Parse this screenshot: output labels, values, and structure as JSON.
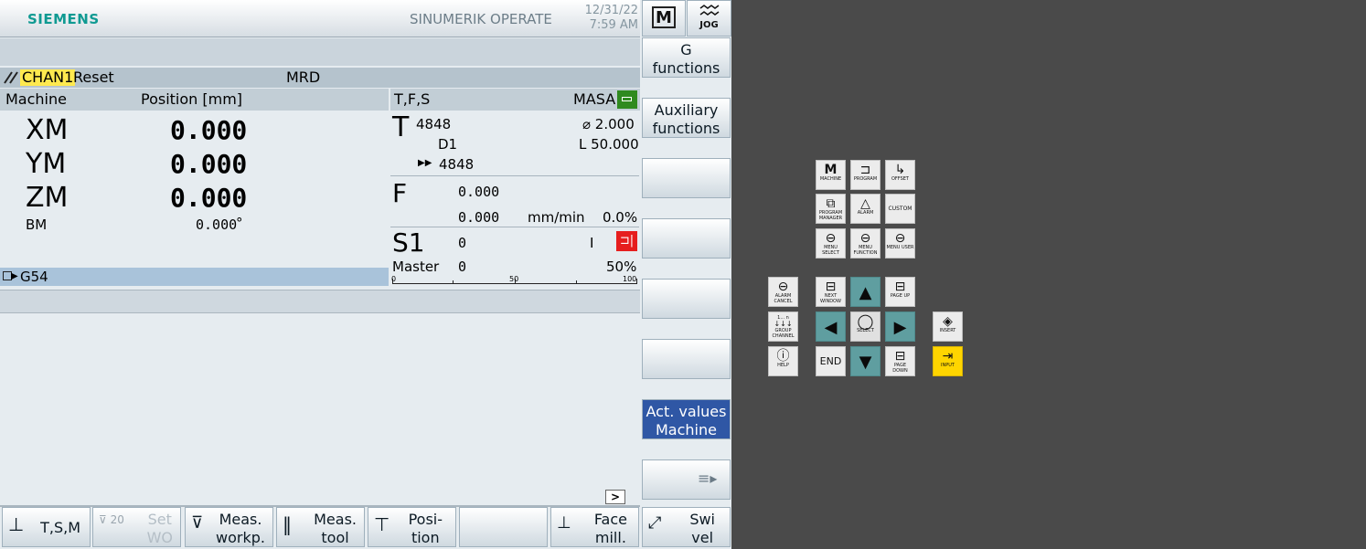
{
  "header": {
    "brand": "SIEMENS",
    "title": "SINUMERIK OPERATE",
    "date": "12/31/22",
    "time": "7:59 AM",
    "mode_m_label": "M",
    "mode_jog_label": "JOG"
  },
  "channel": {
    "name": "CHAN1",
    "state": "Reset",
    "program": "MRD"
  },
  "position": {
    "col_machine": "Machine",
    "col_position": "Position [mm]",
    "axes": [
      {
        "name": "XM",
        "value": "0.000"
      },
      {
        "name": "YM",
        "value": "0.000"
      },
      {
        "name": "ZM",
        "value": "0.000"
      }
    ],
    "bm_name": "BM",
    "bm_value": "0.000",
    "bm_unit": "°",
    "work_offset": "G54"
  },
  "tfs": {
    "header": "T,F,S",
    "masa": "MASA",
    "tool_letter": "T",
    "tool_number": "4848",
    "tool_diameter": "⌀ 2.000",
    "tool_d": "D1",
    "tool_length": "L 50.000",
    "next_tool": "4848",
    "feed_letter": "F",
    "feed_value": "0.000",
    "feed_actual": "0.000",
    "feed_unit": "mm/min",
    "feed_override": "0.0%",
    "spindle_letter": "S1",
    "spindle_value": "0",
    "spindle_dir": "I",
    "spindle_master": "Master",
    "spindle_master_value": "0",
    "spindle_override": "50%",
    "spindle_scale": [
      "0",
      "50",
      "100"
    ]
  },
  "workarea": {
    "scroll_label": ">"
  },
  "right_softkeys": [
    {
      "line1": "G",
      "line2": "functions"
    },
    {
      "line1": "Auxiliary",
      "line2": "functions"
    },
    {
      "line1": "",
      "line2": ""
    },
    {
      "line1": "",
      "line2": ""
    },
    {
      "line1": "",
      "line2": ""
    },
    {
      "line1": "",
      "line2": ""
    },
    {
      "line1": "Act. values",
      "line2": "Machine"
    },
    {
      "line1": "",
      "line2": ""
    }
  ],
  "bottom_softkeys": [
    {
      "line1": "T,S,M",
      "line2": ""
    },
    {
      "line1": "Set",
      "line2": "WO",
      "badge": "20"
    },
    {
      "line1": "Meas.",
      "line2": "workp."
    },
    {
      "line1": "Meas.",
      "line2": "tool"
    },
    {
      "line1": "Posi-",
      "line2": "tion"
    },
    {
      "line1": "",
      "line2": ""
    },
    {
      "line1": "Face",
      "line2": "mill."
    },
    {
      "line1": "Swi",
      "line2": "vel"
    }
  ],
  "keypad": {
    "machine": "MACHINE",
    "program": "PROGRAM",
    "offset": "OFFSET",
    "program_manager": "PROGRAM MANAGER",
    "alarm": "ALARM",
    "custom": "CUSTOM",
    "menu_select": "MENU SELECT",
    "menu_function": "MENU FUNCTION",
    "menu_user": "MENU USER",
    "alarm_cancel": "ALARM CANCEL",
    "next_window": "NEXT WINDOW",
    "page_up": "PAGE UP",
    "group_channel": "GROUP CHANNEL",
    "select": "SELECT",
    "insert": "INSERT",
    "help": "HELP",
    "end": "END",
    "page_down": "PAGE DOWN",
    "input": "INPUT",
    "group_range": "1... n"
  }
}
